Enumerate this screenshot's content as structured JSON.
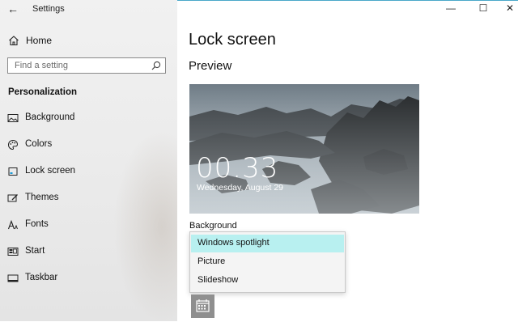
{
  "window": {
    "title": "Settings",
    "back_glyph": "←",
    "controls": {
      "minimize": "—",
      "maximize": "☐",
      "close": "✕"
    }
  },
  "sidebar": {
    "home_label": "Home",
    "search": {
      "placeholder": "Find a setting"
    },
    "section_title": "Personalization",
    "items": [
      {
        "label": "Background",
        "icon": "picture-icon"
      },
      {
        "label": "Colors",
        "icon": "palette-icon"
      },
      {
        "label": "Lock screen",
        "icon": "lock-screen-icon",
        "active": true
      },
      {
        "label": "Themes",
        "icon": "themes-icon"
      },
      {
        "label": "Fonts",
        "icon": "fonts-icon"
      },
      {
        "label": "Start",
        "icon": "start-icon"
      },
      {
        "label": "Taskbar",
        "icon": "taskbar-icon"
      }
    ]
  },
  "main": {
    "title": "Lock screen",
    "preview_heading": "Preview",
    "preview": {
      "time": "00.33",
      "date": "Wednesday, August 29"
    },
    "background_label": "Background",
    "background_options": [
      {
        "label": "Windows spotlight",
        "selected": true
      },
      {
        "label": "Picture",
        "selected": false
      },
      {
        "label": "Slideshow",
        "selected": false
      }
    ]
  },
  "colors": {
    "selected_option_bg": "#b8f0f0",
    "accent_line": "#4aa8c9"
  }
}
